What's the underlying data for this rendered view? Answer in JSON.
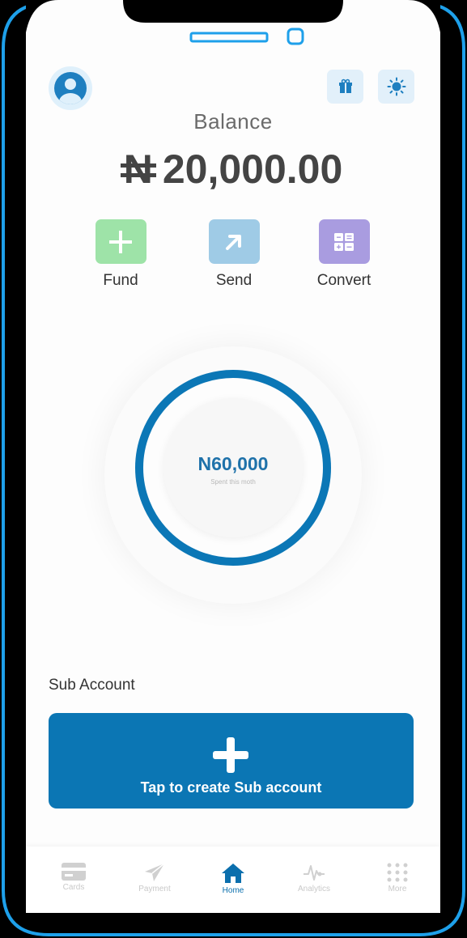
{
  "colors": {
    "accent": "#0b77b6",
    "frame": "#1ea0ea",
    "fund": "#9ee3a8",
    "send": "#9fcbe6",
    "convert": "#a99ce0"
  },
  "header": {
    "avatar_icon": "user-icon",
    "gift_icon": "gift-icon",
    "theme_icon": "sun-icon"
  },
  "balance": {
    "label": "Balance",
    "currency_symbol": "N",
    "amount": "20,000.00"
  },
  "actions": [
    {
      "label": "Fund",
      "icon": "plus-icon"
    },
    {
      "label": "Send",
      "icon": "arrow-up-right-icon"
    },
    {
      "label": "Convert",
      "icon": "calculator-icon"
    }
  ],
  "spending": {
    "amount": "N60,000",
    "label": "Spent this moth"
  },
  "sub_account": {
    "title": "Sub Account",
    "cta": "Tap to create Sub account",
    "icon": "plus-icon"
  },
  "nav": [
    {
      "label": "Cards",
      "icon": "card-icon",
      "active": false
    },
    {
      "label": "Payment",
      "icon": "send-icon",
      "active": false
    },
    {
      "label": "Home",
      "icon": "home-icon",
      "active": true
    },
    {
      "label": "Analytics",
      "icon": "pulse-icon",
      "active": false
    },
    {
      "label": "More",
      "icon": "grid-icon",
      "active": false
    }
  ]
}
